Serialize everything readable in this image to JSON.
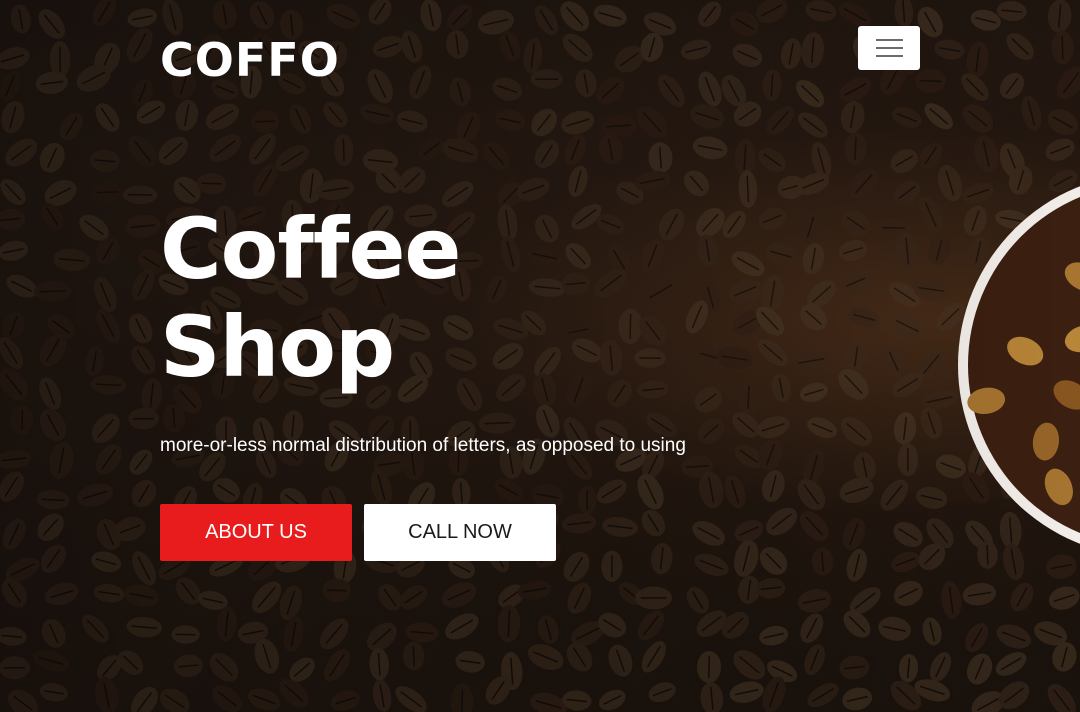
{
  "brand": {
    "logo_text": "COFFO"
  },
  "nav": {
    "menu_icon": "hamburger-menu-icon"
  },
  "hero": {
    "headline_line1": "Coffee",
    "headline_line2": "Shop",
    "subtitle": "more-or-less normal distribution of letters, as opposed to using",
    "background": "coffee-beans-photo"
  },
  "buttons": {
    "about_label": "ABOUT US",
    "call_label": "CALL NOW"
  },
  "colors": {
    "accent": "#e81c1c",
    "text": "#ffffff",
    "secondary_button": "#ffffff"
  }
}
